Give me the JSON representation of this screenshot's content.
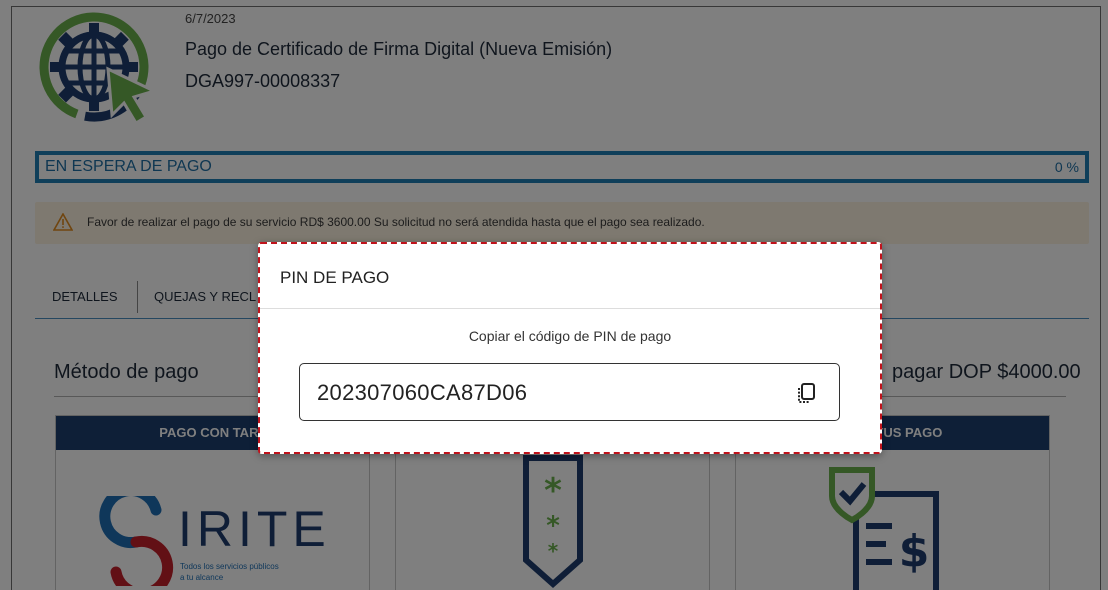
{
  "header": {
    "date": "6/7/2023",
    "title": "Pago de Certificado de Firma Digital (Nueva Emisión)",
    "code": "DGA997-00008337"
  },
  "status": {
    "label": "EN ESPERA DE PAGO",
    "percent_text": "0 %",
    "progress": 0,
    "color": "#1f7fb5"
  },
  "alert": {
    "icon": "warning-icon",
    "text": "Favor de realizar el pago de su servicio RD$ 3600.00 Su solicitud no será atendida hasta que el pago sea realizado."
  },
  "tabs": [
    {
      "label": "DETALLES"
    },
    {
      "label": "QUEJAS Y RECL"
    }
  ],
  "payment": {
    "method_title": "Método de pago",
    "amount_text": "pagar DOP $4000.00",
    "cards": [
      {
        "header": "PAGO CON TARJ",
        "brand": "IRITE",
        "brand_tagline_1": "Todos los servicios públicos",
        "brand_tagline_2": "a tu alcance"
      },
      {
        "header": "",
        "icon": "pin-code-icon"
      },
      {
        "header": "ESTATUS PAGO",
        "icon": "payment-status-icon"
      }
    ]
  },
  "modal": {
    "title": "PIN DE PAGO",
    "subtitle": "Copiar el código de PIN de pago",
    "pin": "202307060CA87D06",
    "copy_icon": "copy-icon"
  },
  "colors": {
    "navy": "#1c3f6e",
    "green": "#6ab04c",
    "blue": "#1f7fb5",
    "highlight": "#c0131c"
  }
}
